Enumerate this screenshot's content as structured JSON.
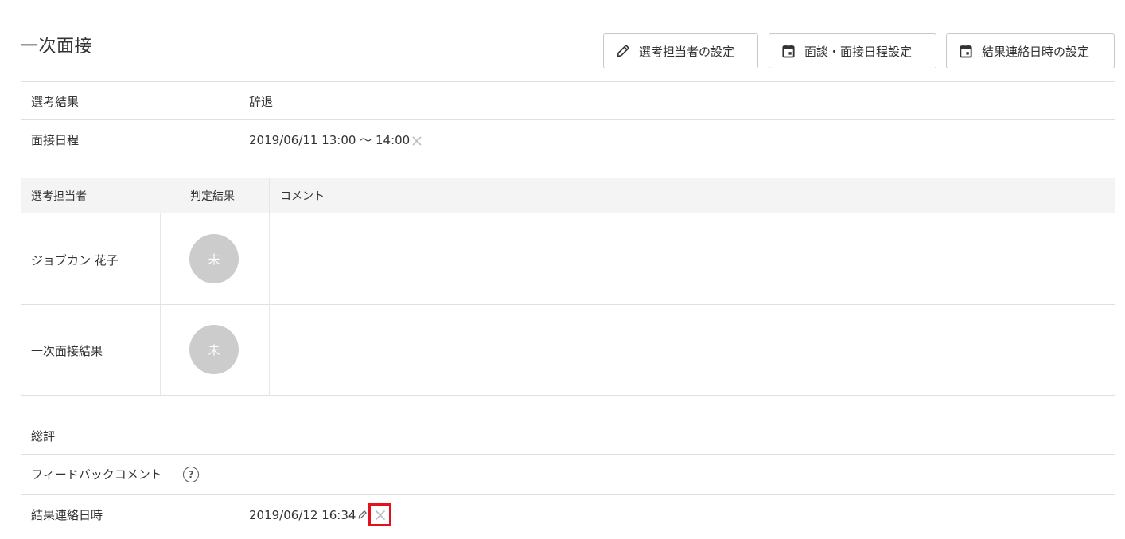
{
  "section": {
    "title": "一次面接"
  },
  "toolbar": {
    "assign_label": "選考担当者の設定",
    "schedule_label": "面談・面接日程設定",
    "contact_label": "結果連絡日時の設定"
  },
  "info": {
    "result_label": "選考結果",
    "result_value": "辞退",
    "schedule_label": "面接日程",
    "schedule_value": "2019/06/11 13:00 〜 14:00"
  },
  "evaluators": {
    "headers": [
      "選考担当者",
      "判定結果",
      "コメント"
    ],
    "rows": [
      {
        "name": "ジョブカン 花子",
        "judgement": "未",
        "comment": ""
      },
      {
        "name": "一次面接結果",
        "judgement": "未",
        "comment": ""
      }
    ]
  },
  "summary": {
    "overall_label": "総評",
    "feedback_label": "フィードバックコメント",
    "help_glyph": "?",
    "contact_label": "結果連絡日時",
    "contact_value": "2019/06/12 16:34"
  },
  "icons": {
    "assign": "pencil-icon",
    "schedule": "calendar-icon",
    "contact": "calendar-icon",
    "remove": "close-icon",
    "edit": "pencil-icon",
    "help": "question-circle-icon"
  },
  "colors": {
    "highlight": "#e6101c",
    "circle": "#cccccc",
    "header_bg": "#f4f4f4"
  }
}
